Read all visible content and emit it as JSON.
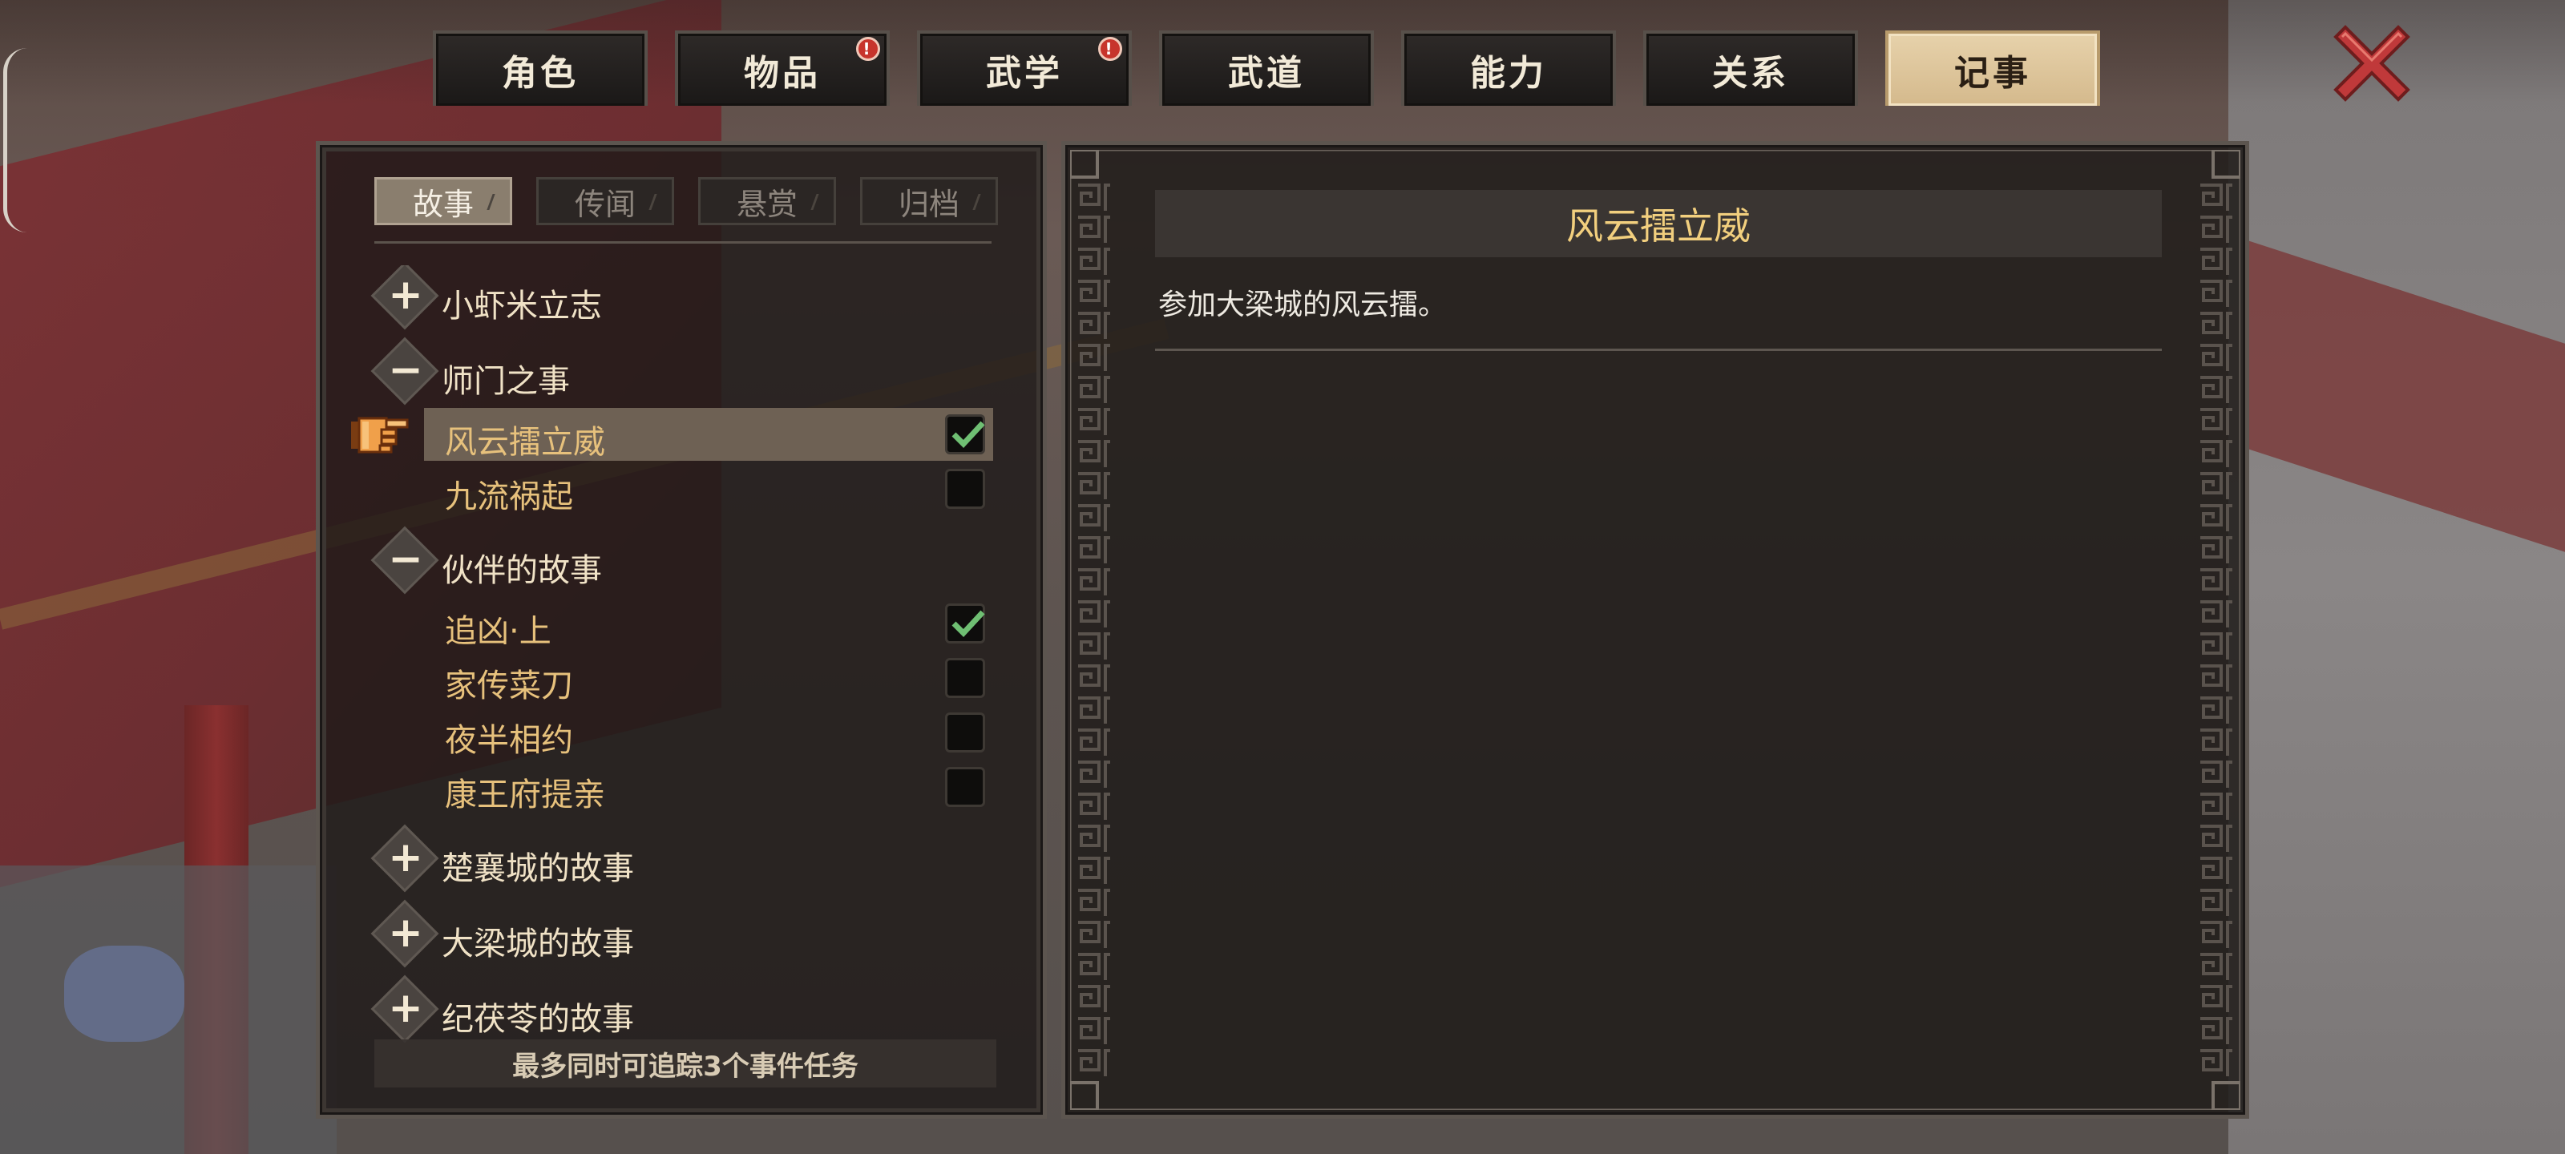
{
  "top_tabs": [
    {
      "label": "角色",
      "badge": false
    },
    {
      "label": "物品",
      "badge": true
    },
    {
      "label": "武学",
      "badge": true
    },
    {
      "label": "武道",
      "badge": false
    },
    {
      "label": "能力",
      "badge": false
    },
    {
      "label": "关系",
      "badge": false
    },
    {
      "label": "记事",
      "badge": false,
      "active": true
    }
  ],
  "badge_symbol": "!",
  "close_icon": "close-x-icon",
  "sub_tabs": [
    {
      "label": "故事",
      "active": true
    },
    {
      "label": "传闻"
    },
    {
      "label": "悬赏"
    },
    {
      "label": "归档"
    }
  ],
  "groups": [
    {
      "label": "小虾米立志",
      "expanded": false,
      "icon": "+"
    },
    {
      "label": "师门之事",
      "expanded": true,
      "icon": "−",
      "quests": [
        {
          "label": "风云擂立威",
          "tracked": true,
          "selected": true
        },
        {
          "label": "九流祸起",
          "tracked": false
        }
      ]
    },
    {
      "label": "伙伴的故事",
      "expanded": true,
      "icon": "−",
      "quests": [
        {
          "label": "追凶·上",
          "tracked": true
        },
        {
          "label": "家传菜刀",
          "tracked": false
        },
        {
          "label": "夜半相约",
          "tracked": false
        },
        {
          "label": "康王府提亲",
          "tracked": false
        }
      ]
    },
    {
      "label": "楚襄城的故事",
      "expanded": false,
      "icon": "+"
    },
    {
      "label": "大梁城的故事",
      "expanded": false,
      "icon": "+"
    },
    {
      "label": "纪茯苓的故事",
      "expanded": false,
      "icon": "+"
    }
  ],
  "track_note": "最多同时可追踪3个事件任务",
  "detail": {
    "title": "风云擂立威",
    "description": "参加大梁城的风云擂。"
  },
  "colors": {
    "quest_text": "#e7c17c",
    "title_text": "#f2cf7e",
    "check_green": "#6fbf73",
    "badge_red": "#c7342c",
    "active_tab_bg": "#d4b98c"
  }
}
